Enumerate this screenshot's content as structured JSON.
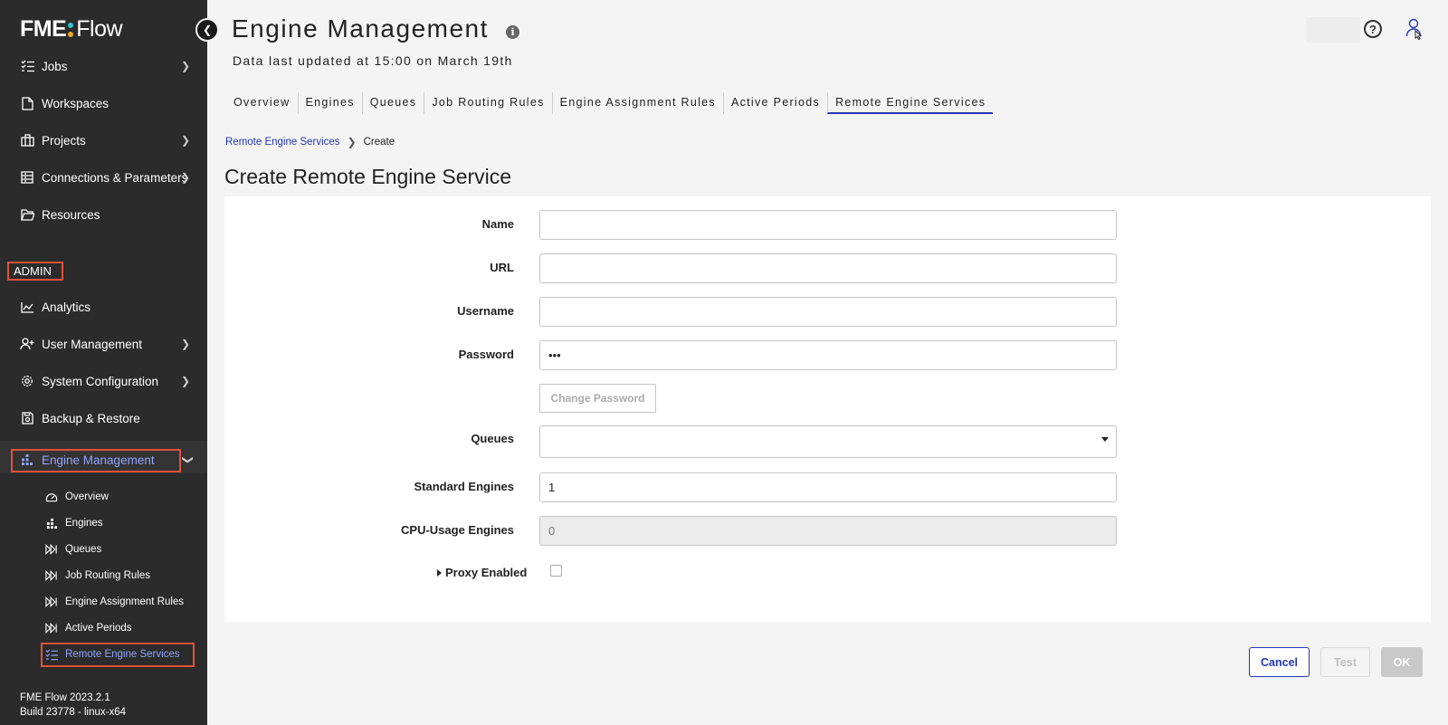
{
  "app": {
    "logo_left": "FME",
    "logo_right": "Flow",
    "logo_dot_colors": [
      "#2ec4d6",
      "#f5a623"
    ],
    "version": "FME Flow 2023.2.1",
    "build": "Build 23778 - linux-x64"
  },
  "sidebar": {
    "items": [
      {
        "label": "Jobs",
        "icon": "list-check-icon",
        "has_chevron": true
      },
      {
        "label": "Workspaces",
        "icon": "file-icon",
        "has_chevron": false
      },
      {
        "label": "Projects",
        "icon": "briefcase-icon",
        "has_chevron": true
      },
      {
        "label": "Connections & Parameters",
        "icon": "database-icon",
        "has_chevron": true
      },
      {
        "label": "Resources",
        "icon": "folder-open-icon",
        "has_chevron": false
      }
    ],
    "admin_label": "ADMIN",
    "admin_items": [
      {
        "label": "Analytics",
        "icon": "chart-line-icon",
        "has_chevron": false
      },
      {
        "label": "User Management",
        "icon": "user-plus-icon",
        "has_chevron": true
      },
      {
        "label": "System Configuration",
        "icon": "gear-icon",
        "has_chevron": true
      },
      {
        "label": "Backup & Restore",
        "icon": "save-icon",
        "has_chevron": false
      },
      {
        "label": "Engine Management",
        "icon": "engines-icon",
        "has_chevron": true,
        "expanded": true
      }
    ],
    "sub_items": [
      {
        "label": "Overview",
        "icon": "gauge-icon"
      },
      {
        "label": "Engines",
        "icon": "engines-icon"
      },
      {
        "label": "Queues",
        "icon": "fast-forward-icon"
      },
      {
        "label": "Job Routing Rules",
        "icon": "fast-forward-icon"
      },
      {
        "label": "Engine Assignment Rules",
        "icon": "fast-forward-icon"
      },
      {
        "label": "Active Periods",
        "icon": "fast-forward-icon"
      },
      {
        "label": "Remote Engine Services",
        "icon": "list-check-icon",
        "active": true
      }
    ],
    "accent_color": "#8fa3ff",
    "highlight_color": "#e0523b"
  },
  "header": {
    "title": "Engine Management",
    "subtitle": "Data last updated at 15:00 on March 19th"
  },
  "tabs": [
    {
      "label": "Overview"
    },
    {
      "label": "Engines"
    },
    {
      "label": "Queues"
    },
    {
      "label": "Job Routing Rules"
    },
    {
      "label": "Engine Assignment Rules"
    },
    {
      "label": "Active Periods"
    },
    {
      "label": "Remote Engine Services",
      "active": true
    }
  ],
  "breadcrumb": {
    "parent": "Remote Engine Services",
    "current": "Create"
  },
  "form": {
    "title": "Create Remote Engine Service",
    "fields": {
      "name": {
        "label": "Name",
        "value": ""
      },
      "url": {
        "label": "URL",
        "value": ""
      },
      "username": {
        "label": "Username",
        "value": ""
      },
      "password": {
        "label": "Password",
        "value": "•••"
      },
      "queues": {
        "label": "Queues",
        "value": ""
      },
      "standard_engines": {
        "label": "Standard Engines",
        "value": "1"
      },
      "cpu_engines": {
        "label": "CPU-Usage Engines",
        "value": "0"
      },
      "proxy": {
        "label": "Proxy Enabled",
        "checked": false
      }
    },
    "change_password_label": "Change Password"
  },
  "actions": {
    "cancel": "Cancel",
    "test": "Test",
    "ok": "OK"
  }
}
